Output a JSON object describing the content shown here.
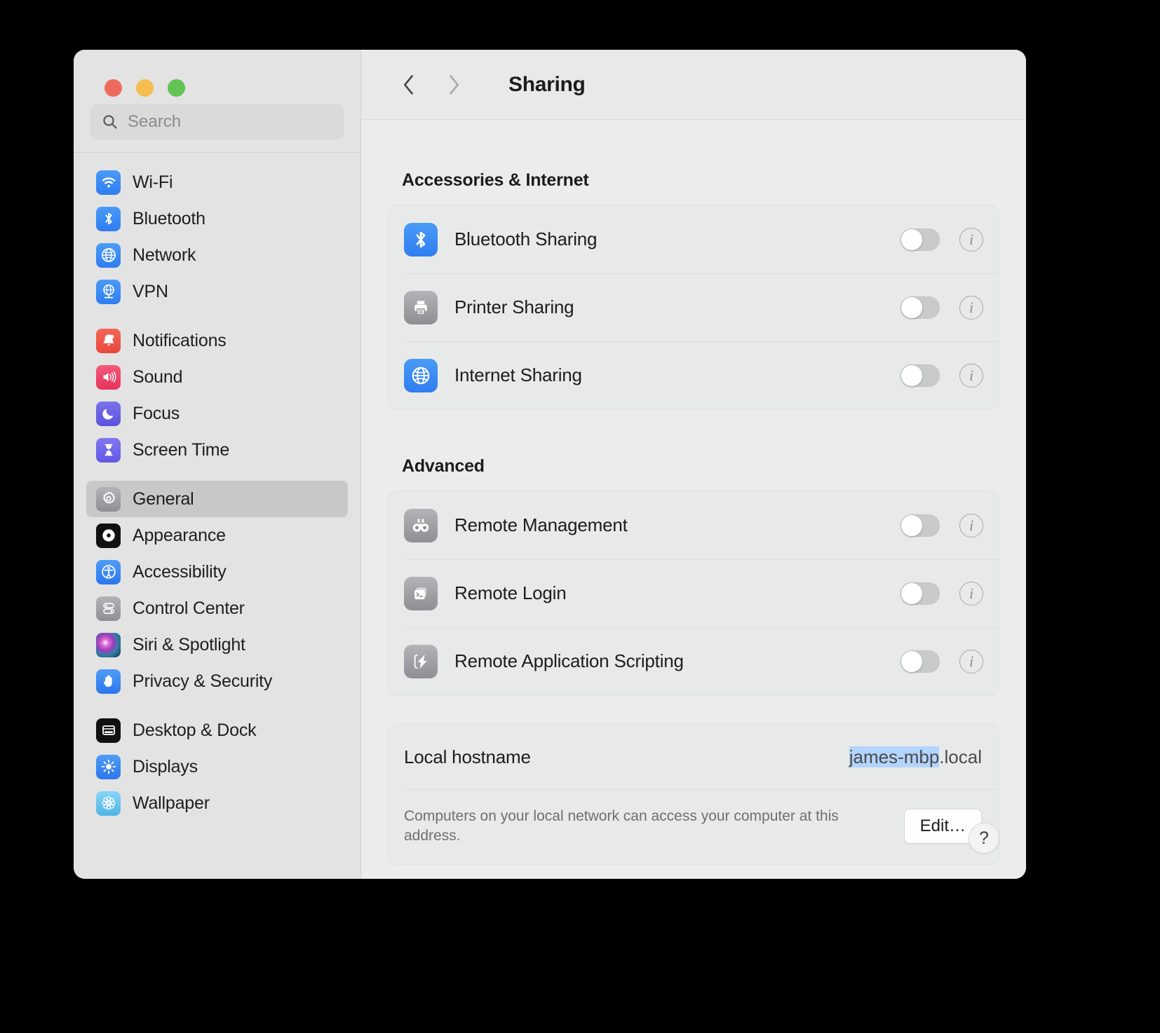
{
  "window": {
    "traffic_lights": [
      "close",
      "minimize",
      "zoom"
    ],
    "colors": {
      "close": "#ee6a5f",
      "minimize": "#f5bd4f",
      "zoom": "#61c454",
      "accent": "#2f7df0",
      "selection": "#b3d4fd"
    }
  },
  "search": {
    "placeholder": "Search",
    "value": "",
    "icon": "search-icon"
  },
  "sidebar": {
    "groups": [
      {
        "items": [
          {
            "label": "Wi-Fi",
            "icon": "wifi-icon",
            "selected": false
          },
          {
            "label": "Bluetooth",
            "icon": "bluetooth-icon",
            "selected": false
          },
          {
            "label": "Network",
            "icon": "globe-icon",
            "selected": false
          },
          {
            "label": "VPN",
            "icon": "vpn-globe-icon",
            "selected": false
          }
        ]
      },
      {
        "items": [
          {
            "label": "Notifications",
            "icon": "bell-icon",
            "selected": false
          },
          {
            "label": "Sound",
            "icon": "speaker-icon",
            "selected": false
          },
          {
            "label": "Focus",
            "icon": "moon-icon",
            "selected": false
          },
          {
            "label": "Screen Time",
            "icon": "hourglass-icon",
            "selected": false
          }
        ]
      },
      {
        "items": [
          {
            "label": "General",
            "icon": "gear-icon",
            "selected": true
          },
          {
            "label": "Appearance",
            "icon": "appearance-icon",
            "selected": false
          },
          {
            "label": "Accessibility",
            "icon": "accessibility-icon",
            "selected": false
          },
          {
            "label": "Control Center",
            "icon": "control-center-icon",
            "selected": false
          },
          {
            "label": "Siri & Spotlight",
            "icon": "siri-icon",
            "selected": false
          },
          {
            "label": "Privacy & Security",
            "icon": "hand-icon",
            "selected": false
          }
        ]
      },
      {
        "items": [
          {
            "label": "Desktop & Dock",
            "icon": "desktop-dock-icon",
            "selected": false
          },
          {
            "label": "Displays",
            "icon": "brightness-icon",
            "selected": false
          },
          {
            "label": "Wallpaper",
            "icon": "wallpaper-flower-icon",
            "selected": false
          }
        ]
      }
    ]
  },
  "toolbar": {
    "back_icon": "chevron-left-icon",
    "forward_icon": "chevron-right-icon",
    "title": "Sharing"
  },
  "main": {
    "sections": [
      {
        "title": "Accessories & Internet",
        "rows": [
          {
            "label": "Bluetooth Sharing",
            "icon": "bluetooth-icon",
            "toggle": "off",
            "info": "info-icon"
          },
          {
            "label": "Printer Sharing",
            "icon": "printer-icon",
            "toggle": "off",
            "info": "info-icon"
          },
          {
            "label": "Internet Sharing",
            "icon": "globe-icon",
            "toggle": "off",
            "info": "info-icon"
          }
        ]
      },
      {
        "title": "Advanced",
        "rows": [
          {
            "label": "Remote Management",
            "icon": "binoculars-icon",
            "toggle": "off",
            "info": "info-icon"
          },
          {
            "label": "Remote Login",
            "icon": "terminal-icon",
            "toggle": "off",
            "info": "info-icon"
          },
          {
            "label": "Remote Application Scripting",
            "icon": "script-bolt-icon",
            "toggle": "off",
            "info": "info-icon"
          }
        ]
      }
    ],
    "hostname": {
      "label": "Local hostname",
      "value_selected": "james-mbp",
      "value_suffix": ".local",
      "description": "Computers on your local network can access your computer at this address.",
      "edit_label": "Edit…"
    },
    "help_label": "?"
  }
}
